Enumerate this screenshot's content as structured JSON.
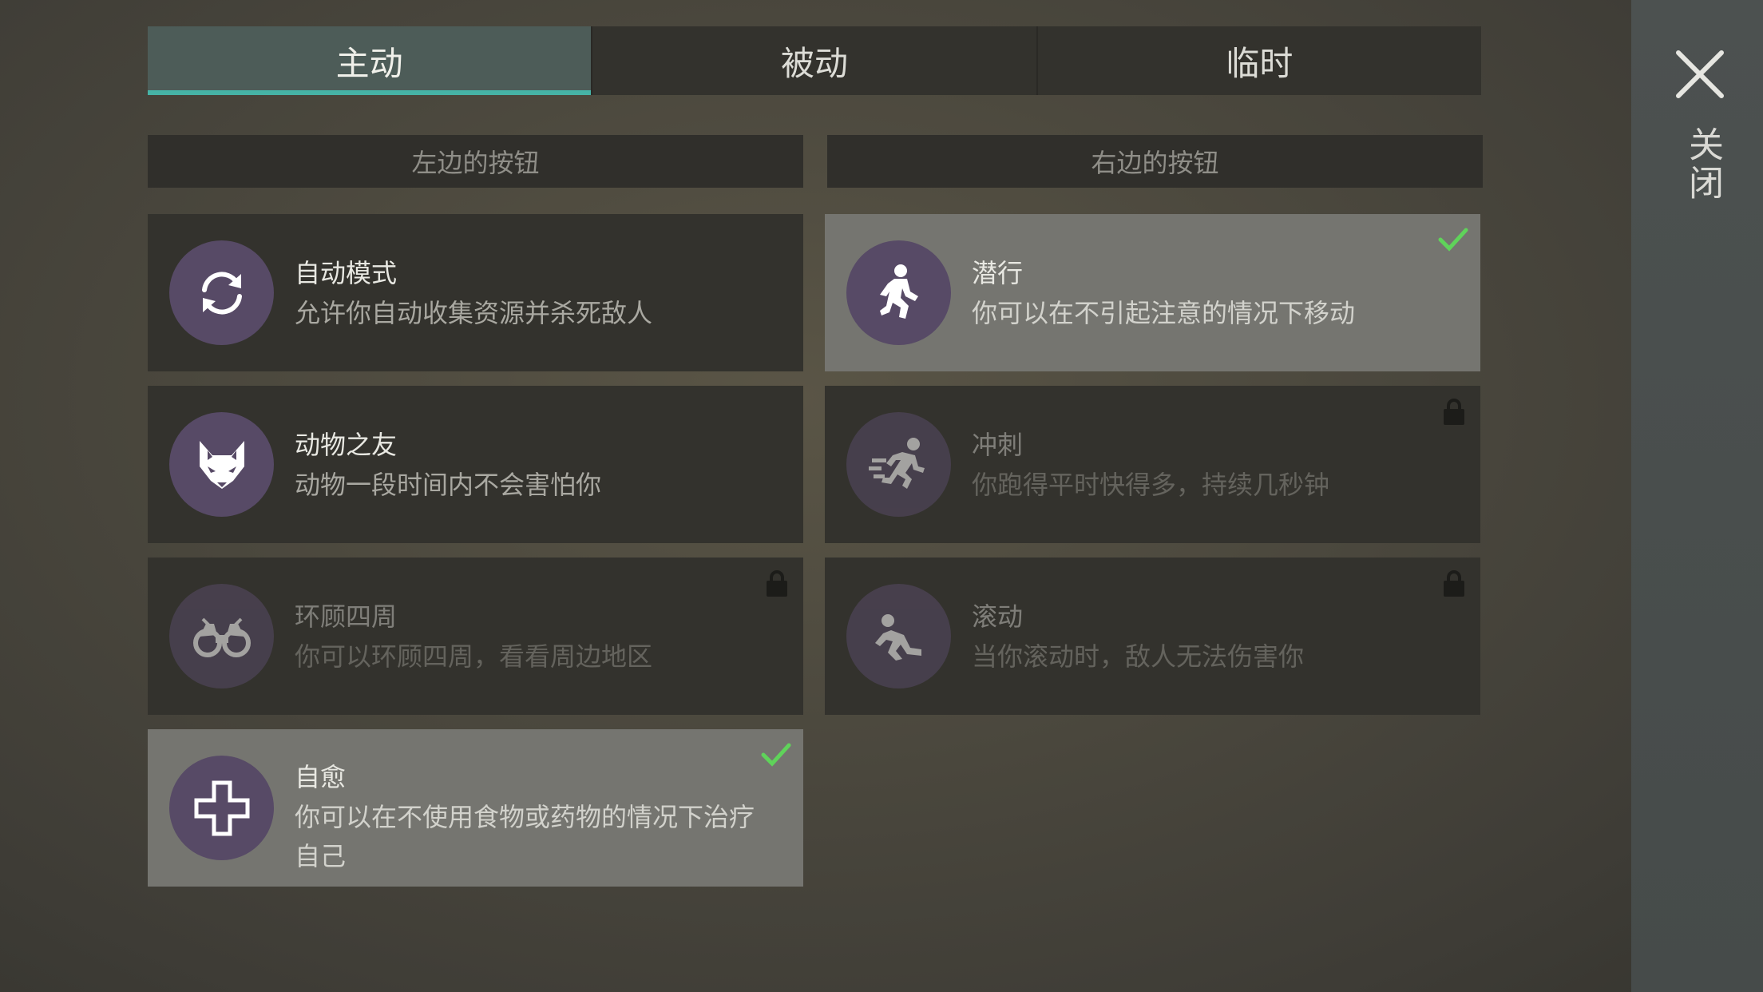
{
  "tabs": [
    {
      "label": "主动",
      "active": true
    },
    {
      "label": "被动",
      "active": false
    },
    {
      "label": "临时",
      "active": false
    }
  ],
  "columns": {
    "left_header": "左边的按钮",
    "right_header": "右边的按钮"
  },
  "close": {
    "label": "关闭",
    "icon": "close-icon"
  },
  "skills": {
    "auto_mode": {
      "title": "自动模式",
      "desc": "允许你自动收集资源并杀死敌人",
      "icon": "refresh-icon",
      "state": "available"
    },
    "animal_friend": {
      "title": "动物之友",
      "desc": "动物一段时间内不会害怕你",
      "icon": "fox-icon",
      "state": "available"
    },
    "look_around": {
      "title": "环顾四周",
      "desc": "你可以环顾四周，看看周边地区",
      "icon": "binoculars-icon",
      "state": "locked"
    },
    "self_heal": {
      "title": "自愈",
      "desc": "你可以在不使用食物或药物的情况下治疗自己",
      "icon": "plus-icon",
      "state": "selected"
    },
    "stealth": {
      "title": "潜行",
      "desc": "你可以在不引起注意的情况下移动",
      "icon": "crouch-icon",
      "state": "selected"
    },
    "sprint": {
      "title": "冲刺",
      "desc": "你跑得平时快得多，持续几秒钟",
      "icon": "sprint-icon",
      "state": "locked"
    },
    "roll": {
      "title": "滚动",
      "desc": "当你滚动时，敌人无法伤害你",
      "icon": "roll-icon",
      "state": "locked"
    }
  },
  "colors": {
    "accent": "#46b3a6",
    "check": "#5fd35a",
    "icon_bg": "#574a66",
    "selected_card": "#757570"
  }
}
